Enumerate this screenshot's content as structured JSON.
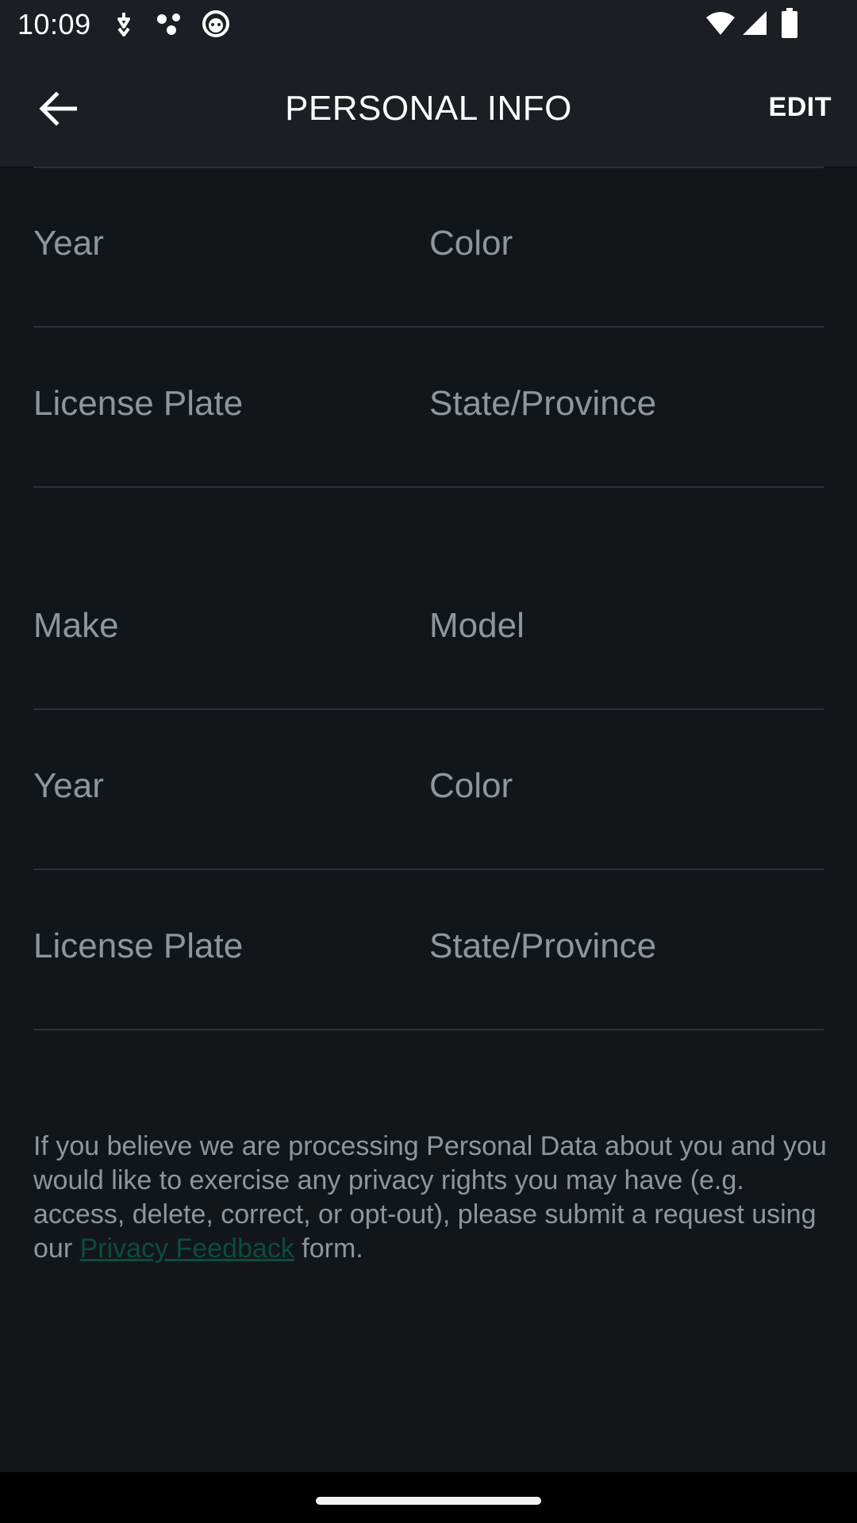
{
  "status_bar": {
    "time": "10:09"
  },
  "app_bar": {
    "title": "PERSONAL INFO",
    "edit_label": "EDIT"
  },
  "vehicles": [
    {
      "fields": [
        {
          "label": "Year"
        },
        {
          "label": "Color"
        },
        {
          "label": "License Plate"
        },
        {
          "label": "State/Province"
        }
      ]
    },
    {
      "fields": [
        {
          "label": "Make"
        },
        {
          "label": "Model"
        },
        {
          "label": "Year"
        },
        {
          "label": "Color"
        },
        {
          "label": "License Plate"
        },
        {
          "label": "State/Province"
        }
      ]
    }
  ],
  "privacy": {
    "text_before": "If you believe we are processing Personal Data about you and you would like to exercise any privacy rights you may have (e.g. access, delete, correct, or opt-out), please submit a request using our ",
    "link_text": "Privacy Feedback",
    "text_after": " form."
  },
  "colors": {
    "background": "#131619",
    "app_bar": "#1b1e22",
    "label_text": "#8f969c",
    "link": "#0b4d3d"
  }
}
